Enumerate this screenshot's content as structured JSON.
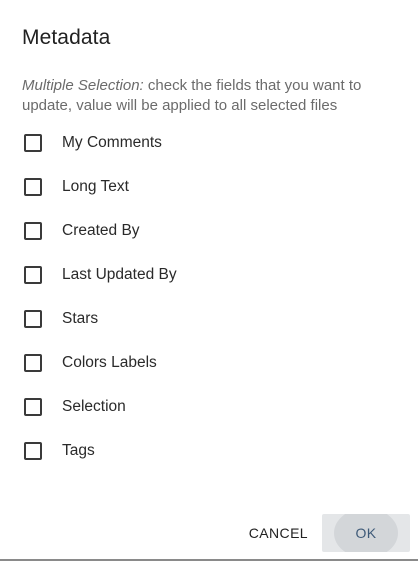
{
  "dialog": {
    "title": "Metadata",
    "description_emphasis": "Multiple Selection:",
    "description_text": " check the fields that you want to update, value will be applied to all selected files",
    "fields": [
      {
        "label": "My Comments",
        "checked": false
      },
      {
        "label": "Long Text",
        "checked": false
      },
      {
        "label": "Created By",
        "checked": false
      },
      {
        "label": "Last Updated By",
        "checked": false
      },
      {
        "label": "Stars",
        "checked": false
      },
      {
        "label": "Colors Labels",
        "checked": false
      },
      {
        "label": "Selection",
        "checked": false
      },
      {
        "label": "Tags",
        "checked": false
      }
    ],
    "actions": {
      "cancel_label": "CANCEL",
      "ok_label": "OK"
    }
  },
  "colors": {
    "ok_text": "#3e5a78",
    "ok_background": "#e4e6e8",
    "description_text": "#6b6b6b"
  }
}
